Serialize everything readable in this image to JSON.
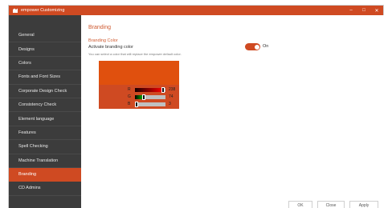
{
  "window": {
    "title": "empower Customizing",
    "logo_icon": "empower-logo-icon",
    "brand_color": "#cf4a22"
  },
  "titlebar": {
    "minimize": "–",
    "maximize": "□",
    "close": "✕"
  },
  "sidebar": {
    "items": [
      {
        "label": "General",
        "active": false
      },
      {
        "label": "Designs",
        "active": false
      },
      {
        "label": "Colors",
        "active": false
      },
      {
        "label": "Fonts and Font Sizes",
        "active": false
      },
      {
        "label": "Corporate Design Check",
        "active": false
      },
      {
        "label": "Consistency Check",
        "active": false
      },
      {
        "label": "Element language",
        "active": false
      },
      {
        "label": "Features",
        "active": false
      },
      {
        "label": "Spell Checking",
        "active": false
      },
      {
        "label": "Machine Translation",
        "active": false
      },
      {
        "label": "Branding",
        "active": true
      },
      {
        "label": "CD Admins",
        "active": false
      }
    ]
  },
  "main": {
    "section_title": "Branding",
    "group_label": "Branding Color",
    "setting_label": "Activate branding color",
    "setting_description": "You can select a color that will replace the empower default color.",
    "toggle": {
      "on": true,
      "label": "On"
    }
  },
  "picker": {
    "preview_color": "#e0500e",
    "channels": [
      {
        "name": "R",
        "value": "238",
        "level": 0.933,
        "fill": "linear-gradient(to right, #1a0000, #ff0000)"
      },
      {
        "name": "G",
        "value": "74",
        "level": 0.29,
        "fill": "linear-gradient(to right, #000000, #00c800)"
      },
      {
        "name": "B",
        "value": "3",
        "level": 0.012,
        "fill": "#000000"
      }
    ]
  },
  "footer": {
    "ok": "OK",
    "close": "Close",
    "apply": "Apply"
  }
}
